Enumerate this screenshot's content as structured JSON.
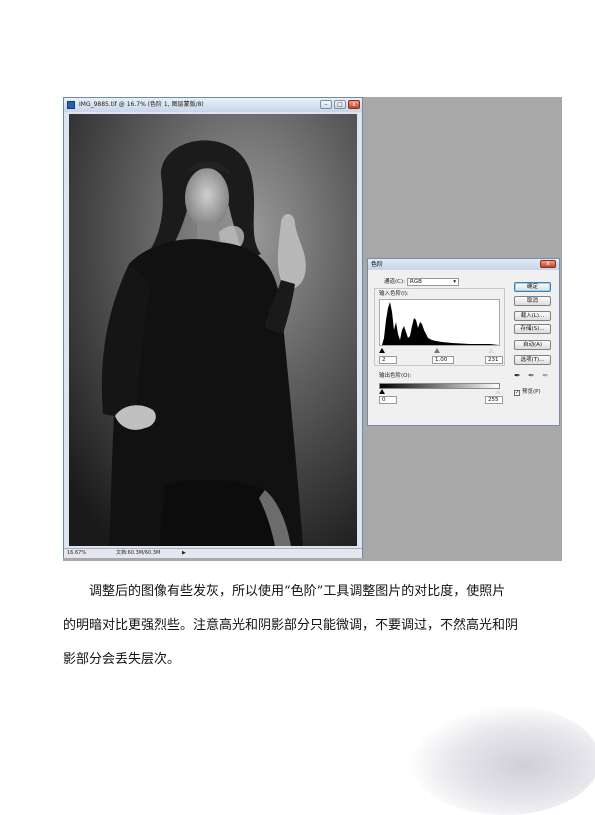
{
  "ps_window": {
    "title": "IMG_9885.tif @ 16.7% (色阶 1, 图层蒙版/8)",
    "controls": [
      "–",
      "□",
      "x"
    ],
    "status_zoom": "16.67%",
    "status_doc": "文档:60.3M/60.3M"
  },
  "levels": {
    "title": "色阶",
    "channel_label": "通道(C):",
    "channel_value": "RGB",
    "input_label": "输入色阶(I):",
    "input_black": "2",
    "input_gamma": "1.00",
    "input_white": "231",
    "output_label": "输出色阶(O):",
    "output_black": "0",
    "output_white": "255",
    "buttons": {
      "ok": "确定",
      "cancel": "取消",
      "load": "载入(L)...",
      "save": "存储(S)...",
      "auto": "自动(A)",
      "options": "选项(T)..."
    },
    "preview_label": "预览(P)",
    "preview_checked": true
  },
  "paragraph": {
    "line1": "调整后的图像有些发灰，所以使用“色阶”工具调整图片的对比度，使照片",
    "line2": "的明暗对比更强烈些。注意高光和阴影部分只能微调，不要调过，不然高光和阴",
    "line3": "影部分会丢失层次。"
  }
}
